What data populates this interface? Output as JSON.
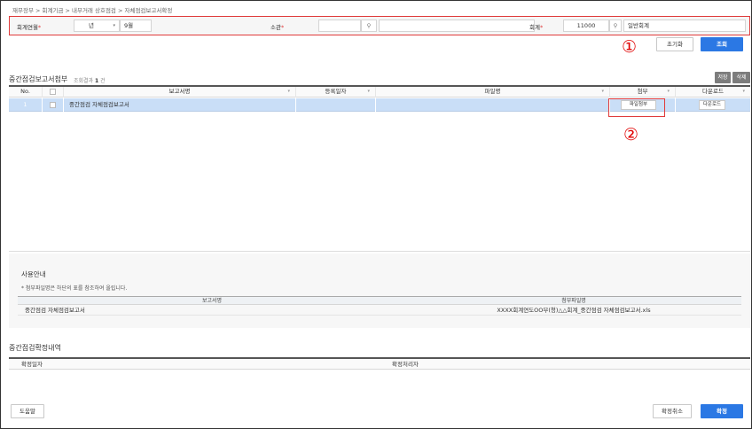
{
  "breadcrumb": "재무장부 > 회계기금 > 내부거래 상호점검 > 자체점검보고서확정",
  "search": {
    "fiscal_year_label": "회계연월",
    "fiscal_year_value": "년",
    "month_value": "9월",
    "dept_label": "소관",
    "dept_code": "",
    "dept_name": "",
    "account_label": "회계",
    "account_code": "11000",
    "account_name": "일반회계",
    "required_mark": "*"
  },
  "buttons": {
    "reset": "초기화",
    "search": "조회",
    "save": "저장",
    "delete": "삭제",
    "help": "도움말",
    "cancel_confirm": "확정취소",
    "confirm": "확정"
  },
  "annotations": {
    "marker_1": "①",
    "marker_2": "②"
  },
  "attach_section": {
    "title": "중간점검보고서첨부",
    "count_label": "조회결과",
    "count_value": "1",
    "count_unit": "건",
    "columns": {
      "no": "No.",
      "report_name": "보고서명",
      "reg_date": "등록일자",
      "file_name": "파일명",
      "attach": "첨부",
      "download": "다운로드"
    },
    "rows": [
      {
        "no": "1",
        "report_name": "중간점검 자체점검보고서",
        "reg_date": "",
        "file_name": "",
        "attach_button": "파일첨부",
        "download_button": "다운로드"
      }
    ]
  },
  "guide": {
    "title": "사용안내",
    "note": "* 첨부파일명은 하단의 표를 참조하여 올립니다.",
    "columns": {
      "report_name": "보고서명",
      "attach_file_name": "첨부파일명"
    },
    "rows": [
      {
        "report_name": "중간점검 자체점검보고서",
        "attach_file_name": "XXXX회계연도OO부(청)△△회계_중간점검 자체점검보고서.xls"
      }
    ]
  },
  "confirm_section": {
    "title": "중간점검확정내역",
    "columns": {
      "confirm_date": "확정일자",
      "confirm_handler": "확정처리자"
    }
  }
}
